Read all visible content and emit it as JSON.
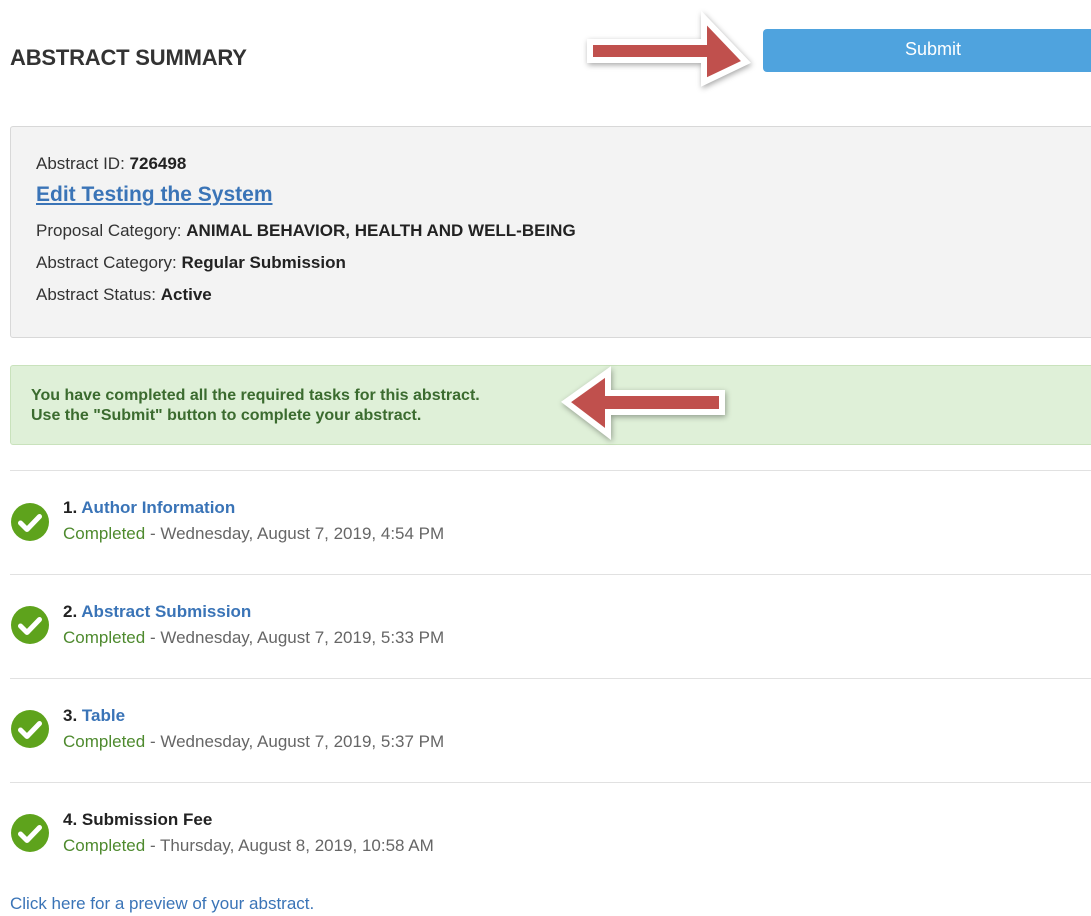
{
  "header": {
    "title": "ABSTRACT SUMMARY",
    "submit_label": "Submit"
  },
  "abstract": {
    "id_label": "Abstract ID:",
    "id_value": "726498",
    "edit_link": "Edit Testing the System",
    "proposal_category_label": "Proposal Category:",
    "proposal_category_value": "ANIMAL BEHAVIOR, HEALTH AND WELL-BEING",
    "abstract_category_label": "Abstract Category:",
    "abstract_category_value": "Regular Submission",
    "status_label": "Abstract Status:",
    "status_value": "Active"
  },
  "alert": {
    "line1": "You have completed all the required tasks for this abstract.",
    "line2": "Use the \"Submit\" button to complete your abstract."
  },
  "tasks": [
    {
      "number": "1.",
      "title": "Author Information",
      "is_link": true,
      "status": "Completed",
      "date": "- Wednesday, August 7, 2019, 4:54 PM"
    },
    {
      "number": "2.",
      "title": "Abstract Submission",
      "is_link": true,
      "status": "Completed",
      "date": "- Wednesday, August 7, 2019, 5:33 PM"
    },
    {
      "number": "3.",
      "title": "Table",
      "is_link": true,
      "status": "Completed",
      "date": "- Wednesday, August 7, 2019, 5:37 PM"
    },
    {
      "number": "4.",
      "title": "Submission Fee",
      "is_link": false,
      "status": "Completed",
      "date": "- Thursday, August 8, 2019, 10:58 AM"
    }
  ],
  "footer": {
    "preview_link": "Click here for a preview of your abstract."
  },
  "colors": {
    "accent": "#4fa3de",
    "link": "#3a74b7",
    "success_green": "#5ea31c",
    "alert_bg": "#dff0d8",
    "arrow_red": "#c0504d"
  },
  "icons": {
    "task_status": "check-circle-icon",
    "callout": "arrow-right-icon"
  }
}
